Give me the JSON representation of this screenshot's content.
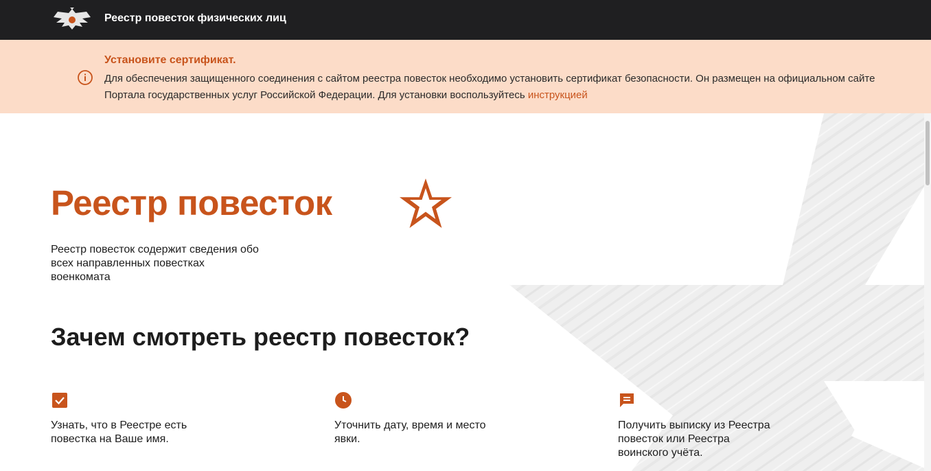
{
  "header": {
    "title": "Реестр повесток физических лиц",
    "logo_icon": "double-headed-eagle-emblem"
  },
  "alert": {
    "icon": "info-circle-icon",
    "title": "Установите сертификат.",
    "text": "Для обеспечения защищенного соединения с сайтом реестра повесток необходимо установить сертификат безопасности. Он размещен на официальном сайте Портала государственных услуг Российской Федерации. Для установки воспользуйтесь ",
    "link_text": "инструкцией"
  },
  "hero": {
    "title": "Реестр повесток",
    "description": "Реестр повесток содержит сведения обо всех направленных повестках военкомата",
    "star_icon": "army-star-icon"
  },
  "why": {
    "title": "Зачем смотреть реестр повесток?",
    "items": [
      {
        "icon": "checkbox-icon",
        "text": "Узнать, что в Реестре есть повестка на Ваше имя."
      },
      {
        "icon": "clock-icon",
        "text": "Уточнить дату, время и место явки."
      },
      {
        "icon": "message-icon",
        "text": "Получить выписку из Реестра повесток или Реестра воинского учёта."
      }
    ]
  },
  "colors": {
    "accent": "#c8541c",
    "header_bg": "#1f1f21",
    "alert_bg": "#fcdcc8",
    "text": "#1d1d1d"
  }
}
